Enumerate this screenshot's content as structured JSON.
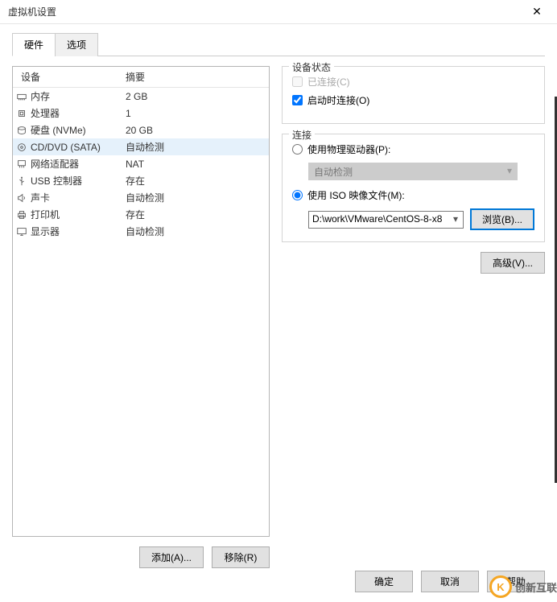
{
  "window": {
    "title": "虚拟机设置"
  },
  "tabs": {
    "hardware": "硬件",
    "options": "选项"
  },
  "listHeader": {
    "device": "设备",
    "summary": "摘要"
  },
  "devices": [
    {
      "icon": "memory",
      "name": "内存",
      "summary": "2 GB"
    },
    {
      "icon": "cpu",
      "name": "处理器",
      "summary": "1"
    },
    {
      "icon": "disk",
      "name": "硬盘 (NVMe)",
      "summary": "20 GB"
    },
    {
      "icon": "cd",
      "name": "CD/DVD (SATA)",
      "summary": "自动检测",
      "selected": true
    },
    {
      "icon": "net",
      "name": "网络适配器",
      "summary": "NAT"
    },
    {
      "icon": "usb",
      "name": "USB 控制器",
      "summary": "存在"
    },
    {
      "icon": "sound",
      "name": "声卡",
      "summary": "自动检测"
    },
    {
      "icon": "printer",
      "name": "打印机",
      "summary": "存在"
    },
    {
      "icon": "display",
      "name": "显示器",
      "summary": "自动检测"
    }
  ],
  "leftButtons": {
    "add": "添加(A)...",
    "remove": "移除(R)"
  },
  "status": {
    "legend": "设备状态",
    "connected": "已连接(C)",
    "connectAtPowerOn": "启动时连接(O)"
  },
  "connection": {
    "legend": "连接",
    "physical": "使用物理驱动器(P):",
    "physicalValue": "自动检测",
    "iso": "使用 ISO 映像文件(M):",
    "isoPath": "D:\\work\\VMware\\CentOS-8-x8",
    "browse": "浏览(B)..."
  },
  "advanced": "高级(V)...",
  "footer": {
    "ok": "确定",
    "cancel": "取消",
    "help": "帮助"
  },
  "watermark": "创新互联"
}
